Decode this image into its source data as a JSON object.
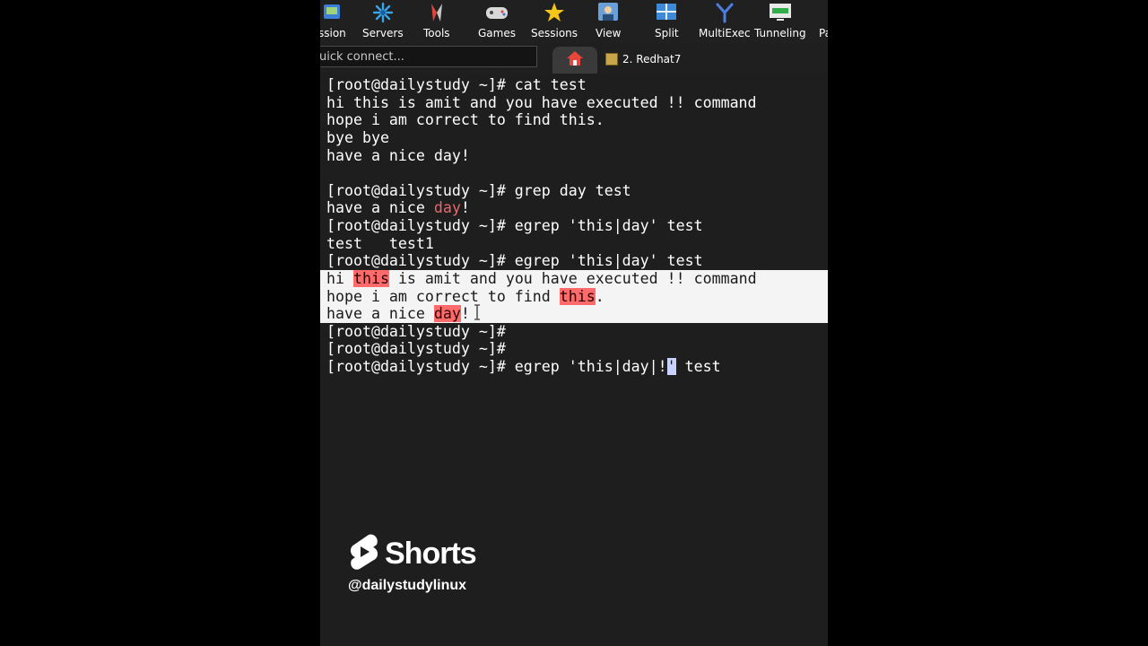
{
  "toolbar": {
    "items": [
      {
        "label": "ssion",
        "icon": "session-icon"
      },
      {
        "label": "Servers",
        "icon": "servers-icon"
      },
      {
        "label": "Tools",
        "icon": "tools-icon"
      },
      {
        "label": "Games",
        "icon": "games-icon"
      },
      {
        "label": "Sessions",
        "icon": "star-icon"
      },
      {
        "label": "View",
        "icon": "view-icon"
      },
      {
        "label": "Split",
        "icon": "split-icon"
      },
      {
        "label": "MultiExec",
        "icon": "multiexec-icon"
      },
      {
        "label": "Tunneling",
        "icon": "tunneling-icon"
      },
      {
        "label": "Pa",
        "icon": "packages-icon"
      }
    ]
  },
  "quick_connect": {
    "placeholder": "uick connect..."
  },
  "tabs": {
    "home_icon": "home-icon",
    "session_label": "2. Redhat7"
  },
  "terminal": {
    "l1": "[root@dailystudy ~]# cat test",
    "l2": "hi this is amit and you have executed !! command",
    "l3": "hope i am correct to find this.",
    "l4": "bye bye",
    "l5": "have a nice day!",
    "l7": "[root@dailystudy ~]# grep day test",
    "l8a": "have a nice ",
    "l8b": "day",
    "l8c": "!",
    "l9": "[root@dailystudy ~]# egrep 'this|day' test",
    "l10": "test   test1",
    "l11": "[root@dailystudy ~]# egrep 'this|day' test",
    "s1a": "hi ",
    "s1b": "this",
    "s1c": " is amit and you have executed !! command",
    "s2a": "hope i am correct to find ",
    "s2b": "this",
    "s2c": ".",
    "s3a": "have a nice ",
    "s3b": "day",
    "s3c": "!",
    "l15": "[root@dailystudy ~]#",
    "l16": "[root@dailystudy ~]#",
    "l17a": "[root@dailystudy ~]# egrep 'this|day|!",
    "l17b": "'",
    "l17c": " test"
  },
  "overlay": {
    "shorts_label": "Shorts",
    "handle": "@dailystudylinux"
  },
  "colors": {
    "terminal_bg": "#1e1e1e",
    "match_red": "#e8676b",
    "selection_bg": "#f4f4f4"
  }
}
